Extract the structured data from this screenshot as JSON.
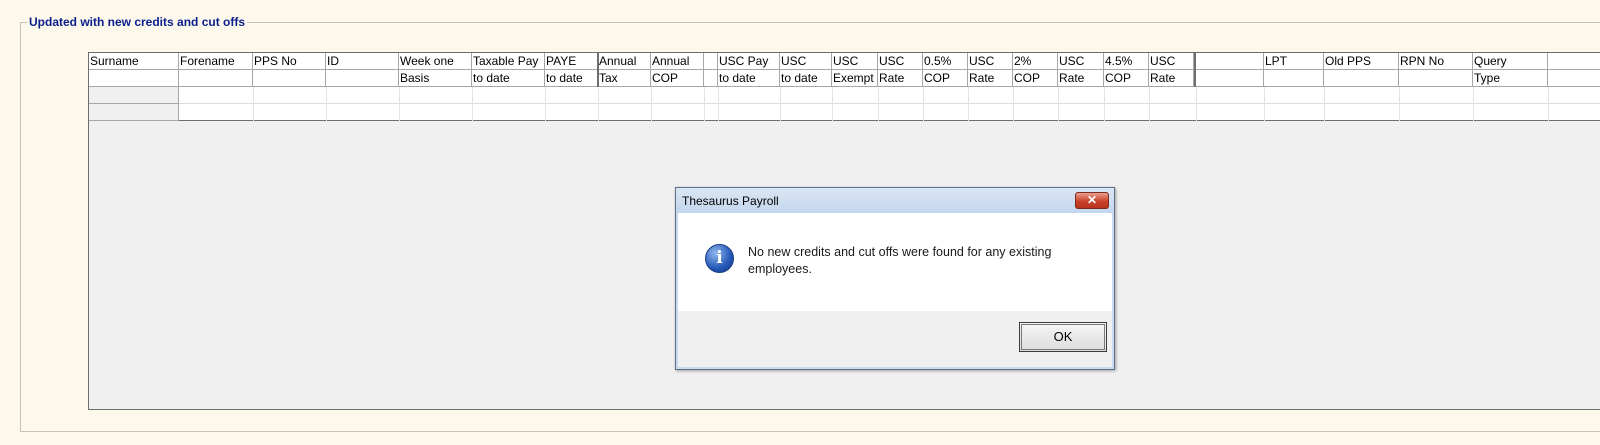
{
  "section_title": "Updated with new credits and cut offs",
  "columns": [
    {
      "l1": "Surname",
      "l2": ""
    },
    {
      "l1": "Forename",
      "l2": ""
    },
    {
      "l1": "PPS No",
      "l2": ""
    },
    {
      "l1": "ID",
      "l2": ""
    },
    {
      "l1": "Week one",
      "l2": "Basis"
    },
    {
      "l1": "Taxable Pay",
      "l2": "to date"
    },
    {
      "l1": "PAYE",
      "l2": "to date"
    },
    {
      "l1": "Annual",
      "l2": "Tax"
    },
    {
      "l1": "Annual",
      "l2": "COP"
    },
    {
      "l1": "",
      "l2": ""
    },
    {
      "l1": "USC Pay",
      "l2": "to date"
    },
    {
      "l1": "USC",
      "l2": "to date"
    },
    {
      "l1": "USC",
      "l2": "Exempt"
    },
    {
      "l1": "USC",
      "l2": "Rate"
    },
    {
      "l1": "0.5%",
      "l2": "COP"
    },
    {
      "l1": "USC",
      "l2": "Rate"
    },
    {
      "l1": "2%",
      "l2": "COP"
    },
    {
      "l1": "USC",
      "l2": "Rate"
    },
    {
      "l1": "4.5%",
      "l2": "COP"
    },
    {
      "l1": "USC",
      "l2": "Rate"
    },
    {
      "l1": "",
      "l2": ""
    },
    {
      "l1": "LPT",
      "l2": ""
    },
    {
      "l1": "Old PPS",
      "l2": ""
    },
    {
      "l1": "RPN No",
      "l2": ""
    },
    {
      "l1": "Query",
      "l2": "Type"
    }
  ],
  "dialog": {
    "title": "Thesaurus Payroll",
    "message": "No new credits and cut offs were found for any existing employees.",
    "ok_label": "OK",
    "close_glyph": "✕",
    "icon": "info-icon",
    "icon_glyph": "i"
  }
}
